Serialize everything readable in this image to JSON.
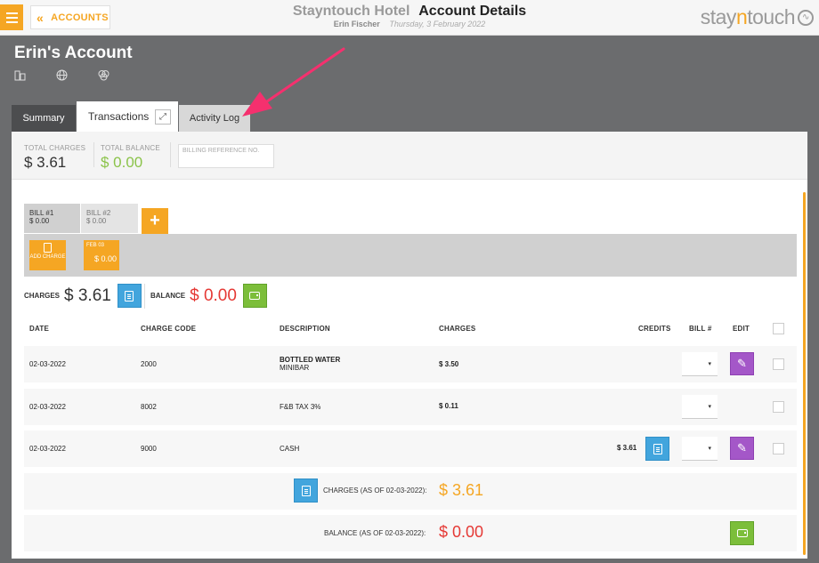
{
  "header": {
    "back_label": "ACCOUNTS",
    "hotel_name": "Stayntouch Hotel",
    "page_title": "Account Details",
    "user": "Erin Fischer",
    "date": "Thursday, 3 February 2022",
    "logo_pre": "stay",
    "logo_mid": "n",
    "logo_post": "touch"
  },
  "account": {
    "title": "Erin's Account",
    "icons": [
      "building-icon",
      "globe-icon",
      "circles-icon"
    ]
  },
  "tabs": [
    {
      "label": "Summary"
    },
    {
      "label": "Transactions"
    },
    {
      "label": "Activity Log"
    }
  ],
  "totals": {
    "charges_label": "TOTAL CHARGES",
    "charges_value": "$ 3.61",
    "balance_label": "TOTAL BALANCE",
    "balance_value": "$ 0.00",
    "billing_ref_placeholder": "BILLING REFERENCE NO."
  },
  "bills": [
    {
      "label": "BILL #1",
      "amount": "$ 0.00"
    },
    {
      "label": "BILL #2",
      "amount": "$ 0.00"
    }
  ],
  "add_bill_label": "+",
  "add_charge_label": "ADD CHARGE",
  "day_chip": {
    "date": "FEB 03",
    "amount": "$ 0.00"
  },
  "summary": {
    "charges_label": "CHARGES",
    "charges_value": "$ 3.61",
    "balance_label": "BALANCE",
    "balance_value": "$ 0.00"
  },
  "table": {
    "columns": [
      "DATE",
      "CHARGE CODE",
      "DESCRIPTION",
      "CHARGES",
      "CREDITS",
      "BILL #",
      "EDIT"
    ],
    "rows": [
      {
        "date": "02-03-2022",
        "code": "2000",
        "desc": "BOTTLED WATER",
        "desc2": "MINIBAR",
        "charges": "$ 3.50",
        "credits": ""
      },
      {
        "date": "02-03-2022",
        "code": "8002",
        "desc": "F&B TAX 3%",
        "desc2": "",
        "charges": "$ 0.11",
        "credits": ""
      },
      {
        "date": "02-03-2022",
        "code": "9000",
        "desc": "CASH",
        "desc2": "",
        "charges": "",
        "credits": "$ 3.61"
      }
    ],
    "charges_total_label": "CHARGES (AS OF 02-03-2022):",
    "charges_total_value": "$ 3.61",
    "balance_total_label": "BALANCE (AS OF 02-03-2022):",
    "balance_total_value": "$ 0.00"
  },
  "colors": {
    "accent": "#f5a623",
    "balance_red": "#e53935",
    "balance_green": "#8bc34a",
    "annotation_arrow": "#f5306e"
  }
}
